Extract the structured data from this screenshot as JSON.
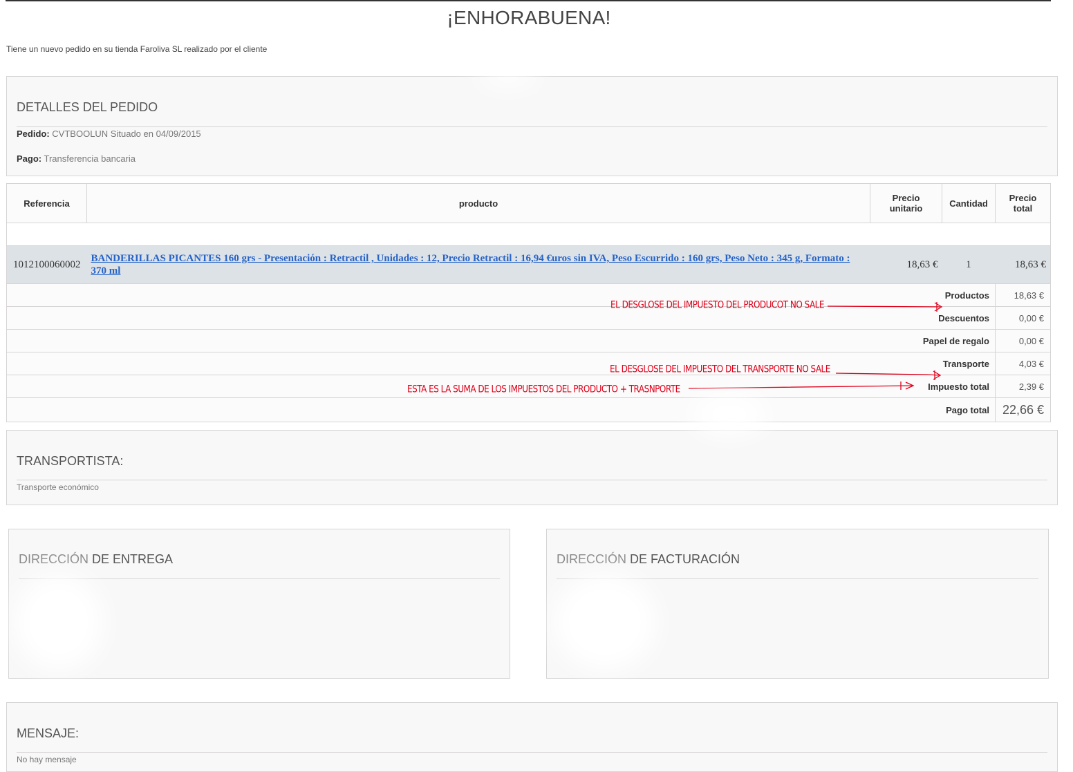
{
  "header": {
    "title": "¡ENHORABUENA!",
    "intro_text": "Tiene un nuevo pedido en su tienda Faroliva SL realizado por el cliente"
  },
  "order_details": {
    "title": "DETALLES DEL PEDIDO",
    "order_label": "Pedido:",
    "order_value": "CVTBOOLUN Situado en 04/09/2015",
    "payment_label": "Pago:",
    "payment_value": "Transferencia bancaria"
  },
  "table": {
    "headers": {
      "reference": "Referencia",
      "product": "producto",
      "unit_price_l1": "Precio",
      "unit_price_l2": "unitario",
      "quantity": "Cantidad",
      "total_price_l1": "Precio",
      "total_price_l2": "total"
    },
    "item": {
      "reference": "1012100060002",
      "product": "BANDERILLAS PICANTES 160 grs - Presentación : Retractil , Unidades : 12, Precio Retractil : 16,94 €uros sin IVA, Peso Escurrido : 160 grs, Peso Neto : 345 g, Formato : 370 ml",
      "unit_price": "18,63 €",
      "quantity": "1",
      "total_price": "18,63 €"
    },
    "summary": [
      {
        "label": "Productos",
        "value": "18,63 €"
      },
      {
        "label": "Descuentos",
        "value": "0,00 €"
      },
      {
        "label": "Papel de regalo",
        "value": "0,00 €"
      },
      {
        "label": "Transporte",
        "value": "4,03 €"
      },
      {
        "label": "Impuesto total",
        "value": "2,39 €"
      },
      {
        "label": "Pago total",
        "value": "22,66 €"
      }
    ]
  },
  "annotations": {
    "product_tax": "EL DESGLOSE DEL IMPUESTO DEL PRODUCOT NO SALE",
    "shipping_tax": "EL DESGLOSE DEL IMPUESTO DEL TRANSPORTE NO SALE",
    "tax_sum": "ESTA ES LA SUMA DE LOS IMPUESTOS DEL PRODUCTO + TRASNPORTE",
    "color": "#e0001a"
  },
  "carrier": {
    "title": "TRANSPORTISTA:",
    "value": "Transporte económico"
  },
  "delivery": {
    "title_a": "DIRECCIÓN",
    "title_b": "DE ENTREGA"
  },
  "billing": {
    "title_a": "DIRECCIÓN",
    "title_b": "DE FACTURACIÓN"
  },
  "message": {
    "title": "MENSAJE:",
    "value": "No hay mensaje"
  }
}
